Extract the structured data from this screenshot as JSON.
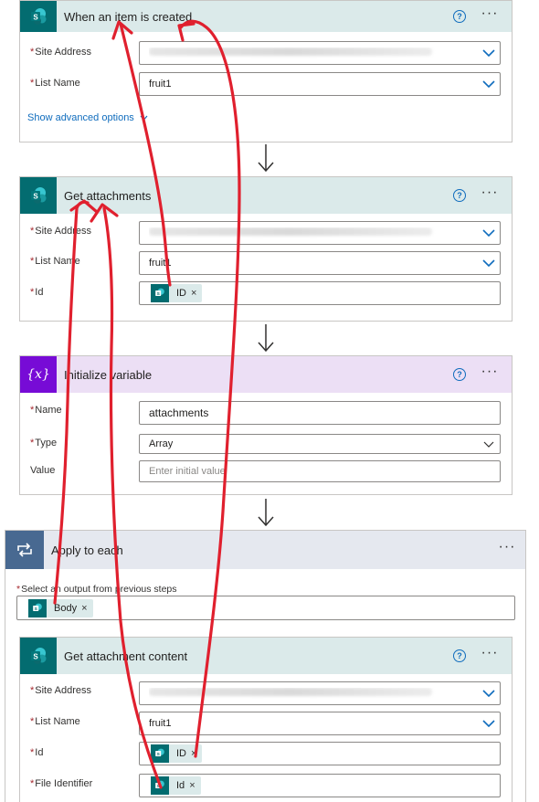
{
  "trigger": {
    "title": "When an item is created",
    "fields": [
      {
        "label": "Site Address",
        "required": true,
        "value": ""
      },
      {
        "label": "List Name",
        "required": true,
        "value": "fruit1"
      }
    ],
    "advanced_link": "Show advanced options"
  },
  "get_attachments": {
    "title": "Get attachments",
    "fields": [
      {
        "label": "Site Address",
        "required": true,
        "value": ""
      },
      {
        "label": "List Name",
        "required": true,
        "value": "fruit1"
      },
      {
        "label": "Id",
        "required": true,
        "token": "ID"
      }
    ]
  },
  "init_variable": {
    "title": "Initialize variable",
    "fields": [
      {
        "label": "Name",
        "required": true,
        "value": "attachments"
      },
      {
        "label": "Type",
        "required": true,
        "value": "Array"
      },
      {
        "label": "Value",
        "required": false,
        "placeholder": "Enter initial value"
      }
    ],
    "icon_text": "{x}"
  },
  "apply_each": {
    "title": "Apply to each",
    "select_label": "Select an output from previous steps",
    "token": "Body"
  },
  "get_content": {
    "title": "Get attachment content",
    "fields": [
      {
        "label": "Site Address",
        "required": true,
        "value": ""
      },
      {
        "label": "List Name",
        "required": true,
        "value": "fruit1"
      },
      {
        "label": "Id",
        "required": true,
        "token": "ID"
      },
      {
        "label": "File Identifier",
        "required": true,
        "token": "Id"
      }
    ]
  },
  "common": {
    "required_mark": "*",
    "more_label": "···",
    "help_label": "?",
    "remove_label": "×"
  },
  "colors": {
    "sharepoint": "#036c70",
    "variable": "#770bd6",
    "loop": "#486991",
    "link": "#0f6cbd",
    "annotation": "#e0202e"
  }
}
